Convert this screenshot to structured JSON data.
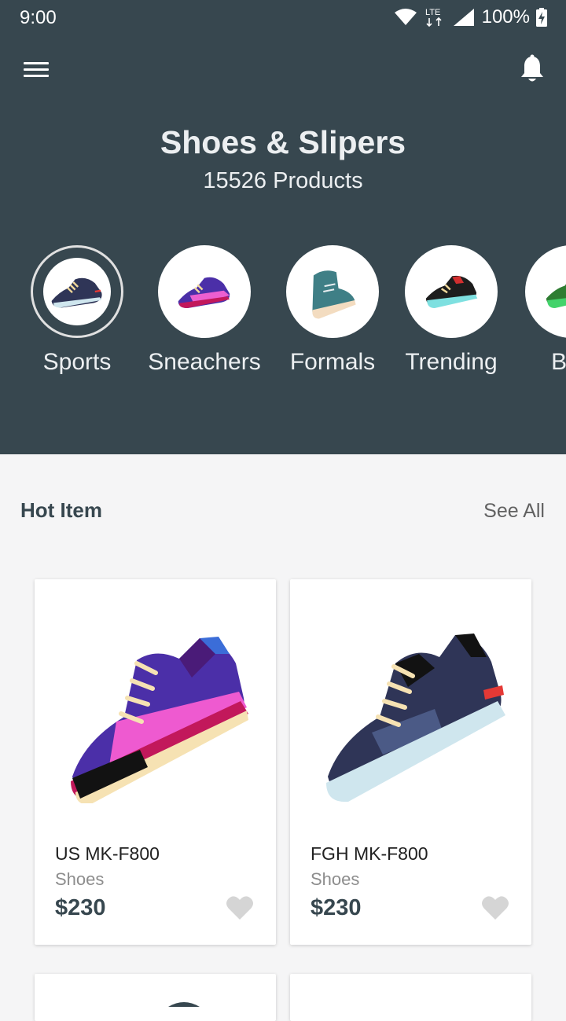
{
  "status_bar": {
    "time": "9:00",
    "network": "LTE",
    "battery": "100%"
  },
  "header": {
    "title": "Shoes & Slipers",
    "subtitle": "15526 Products"
  },
  "categories": [
    {
      "label": "Sports",
      "selected": true
    },
    {
      "label": "Sneachers",
      "selected": false
    },
    {
      "label": "Formals",
      "selected": false
    },
    {
      "label": "Trending",
      "selected": false
    },
    {
      "label": "Bus",
      "selected": false
    }
  ],
  "section": {
    "title": "Hot Item",
    "see_all": "See All"
  },
  "products": [
    {
      "name": "US MK-F800",
      "category": "Shoes",
      "price": "$230"
    },
    {
      "name": "FGH MK-F800",
      "category": "Shoes",
      "price": "$230"
    }
  ],
  "colors": {
    "header_bg": "#37474f",
    "page_bg": "#f5f5f6",
    "heart": "#d5d5d5"
  }
}
